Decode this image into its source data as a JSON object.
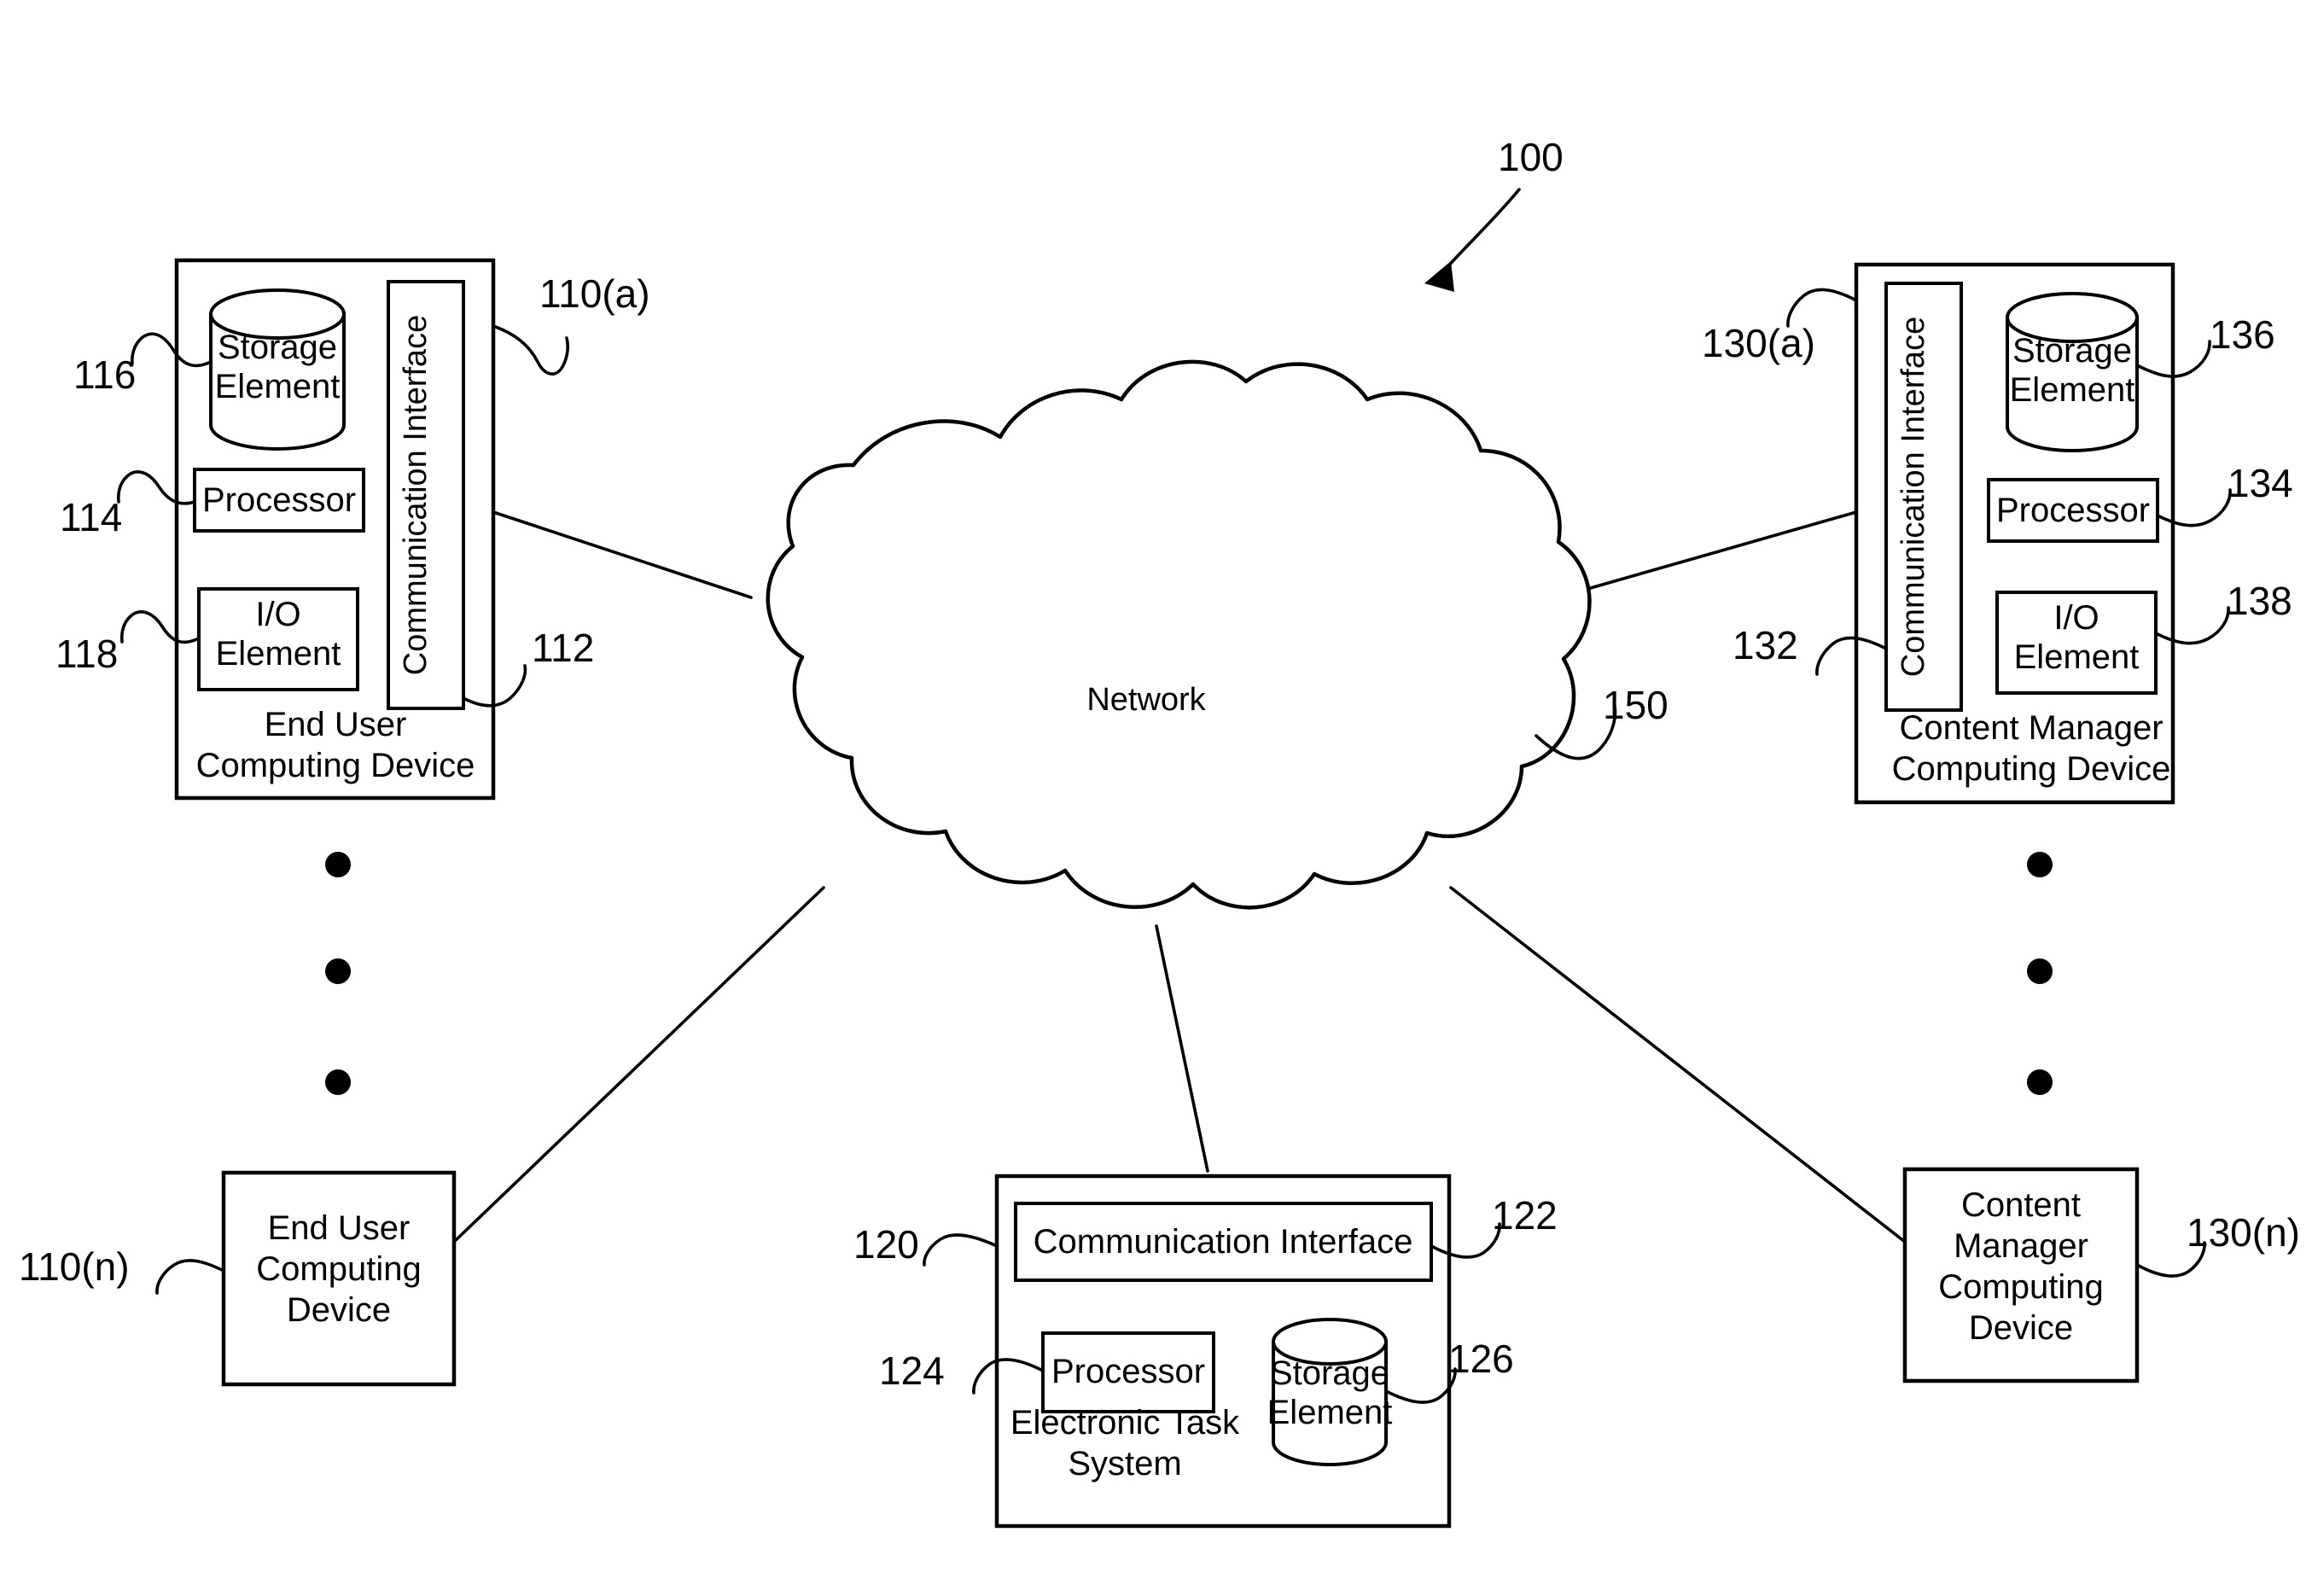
{
  "figure": {
    "system_reference": "100",
    "network": {
      "label": "Network",
      "reference": "150"
    },
    "end_user_device_a": {
      "reference": "110(a)",
      "caption_line1": "End User",
      "caption_line2": "Computing Device",
      "components": [
        {
          "name": "storage-element",
          "label_line1": "Storage",
          "label_line2": "Element",
          "reference": "116",
          "shape": "cylinder"
        },
        {
          "name": "processor",
          "label_line1": "Processor",
          "label_line2": "",
          "reference": "114",
          "shape": "rect"
        },
        {
          "name": "io-element",
          "label_line1": "I/O",
          "label_line2": "Element",
          "reference": "118",
          "shape": "rect"
        },
        {
          "name": "communication-interface",
          "label_line1": "Communication Interface",
          "label_line2": "",
          "reference": "112",
          "shape": "vertical-rect"
        }
      ]
    },
    "end_user_device_n": {
      "reference": "110(n)",
      "caption_line1": "End User",
      "caption_line2": "Computing",
      "caption_line3": "Device"
    },
    "content_manager_device_a": {
      "reference": "130(a)",
      "caption_line1": "Content Manager",
      "caption_line2": "Computing Device",
      "components": [
        {
          "name": "storage-element",
          "label_line1": "Storage",
          "label_line2": "Element",
          "reference": "136",
          "shape": "cylinder"
        },
        {
          "name": "processor",
          "label_line1": "Processor",
          "label_line2": "",
          "reference": "134",
          "shape": "rect"
        },
        {
          "name": "io-element",
          "label_line1": "I/O",
          "label_line2": "Element",
          "reference": "138",
          "shape": "rect"
        },
        {
          "name": "communication-interface",
          "label_line1": "Communication Interface",
          "label_line2": "",
          "reference": "132",
          "shape": "vertical-rect"
        }
      ]
    },
    "content_manager_device_n": {
      "reference": "130(n)",
      "caption_line1": "Content",
      "caption_line2": "Manager",
      "caption_line3": "Computing",
      "caption_line4": "Device"
    },
    "electronic_task_system": {
      "reference": "120",
      "caption_line1": "Electronic Task",
      "caption_line2": "System",
      "components": [
        {
          "name": "communication-interface",
          "label_line1": "Communication Interface",
          "label_line2": "",
          "reference": "122",
          "shape": "rect"
        },
        {
          "name": "processor",
          "label_line1": "Processor",
          "label_line2": "",
          "reference": "124",
          "shape": "rect"
        },
        {
          "name": "storage-element",
          "label_line1": "Storage",
          "label_line2": "Element",
          "reference": "126",
          "shape": "cylinder"
        }
      ]
    },
    "ellipsis": {
      "left_label": "vertical-ellipsis-left",
      "right_label": "vertical-ellipsis-right",
      "dot_count": 3
    },
    "colors": {
      "ink": "#000000",
      "paper": "#ffffff"
    }
  }
}
